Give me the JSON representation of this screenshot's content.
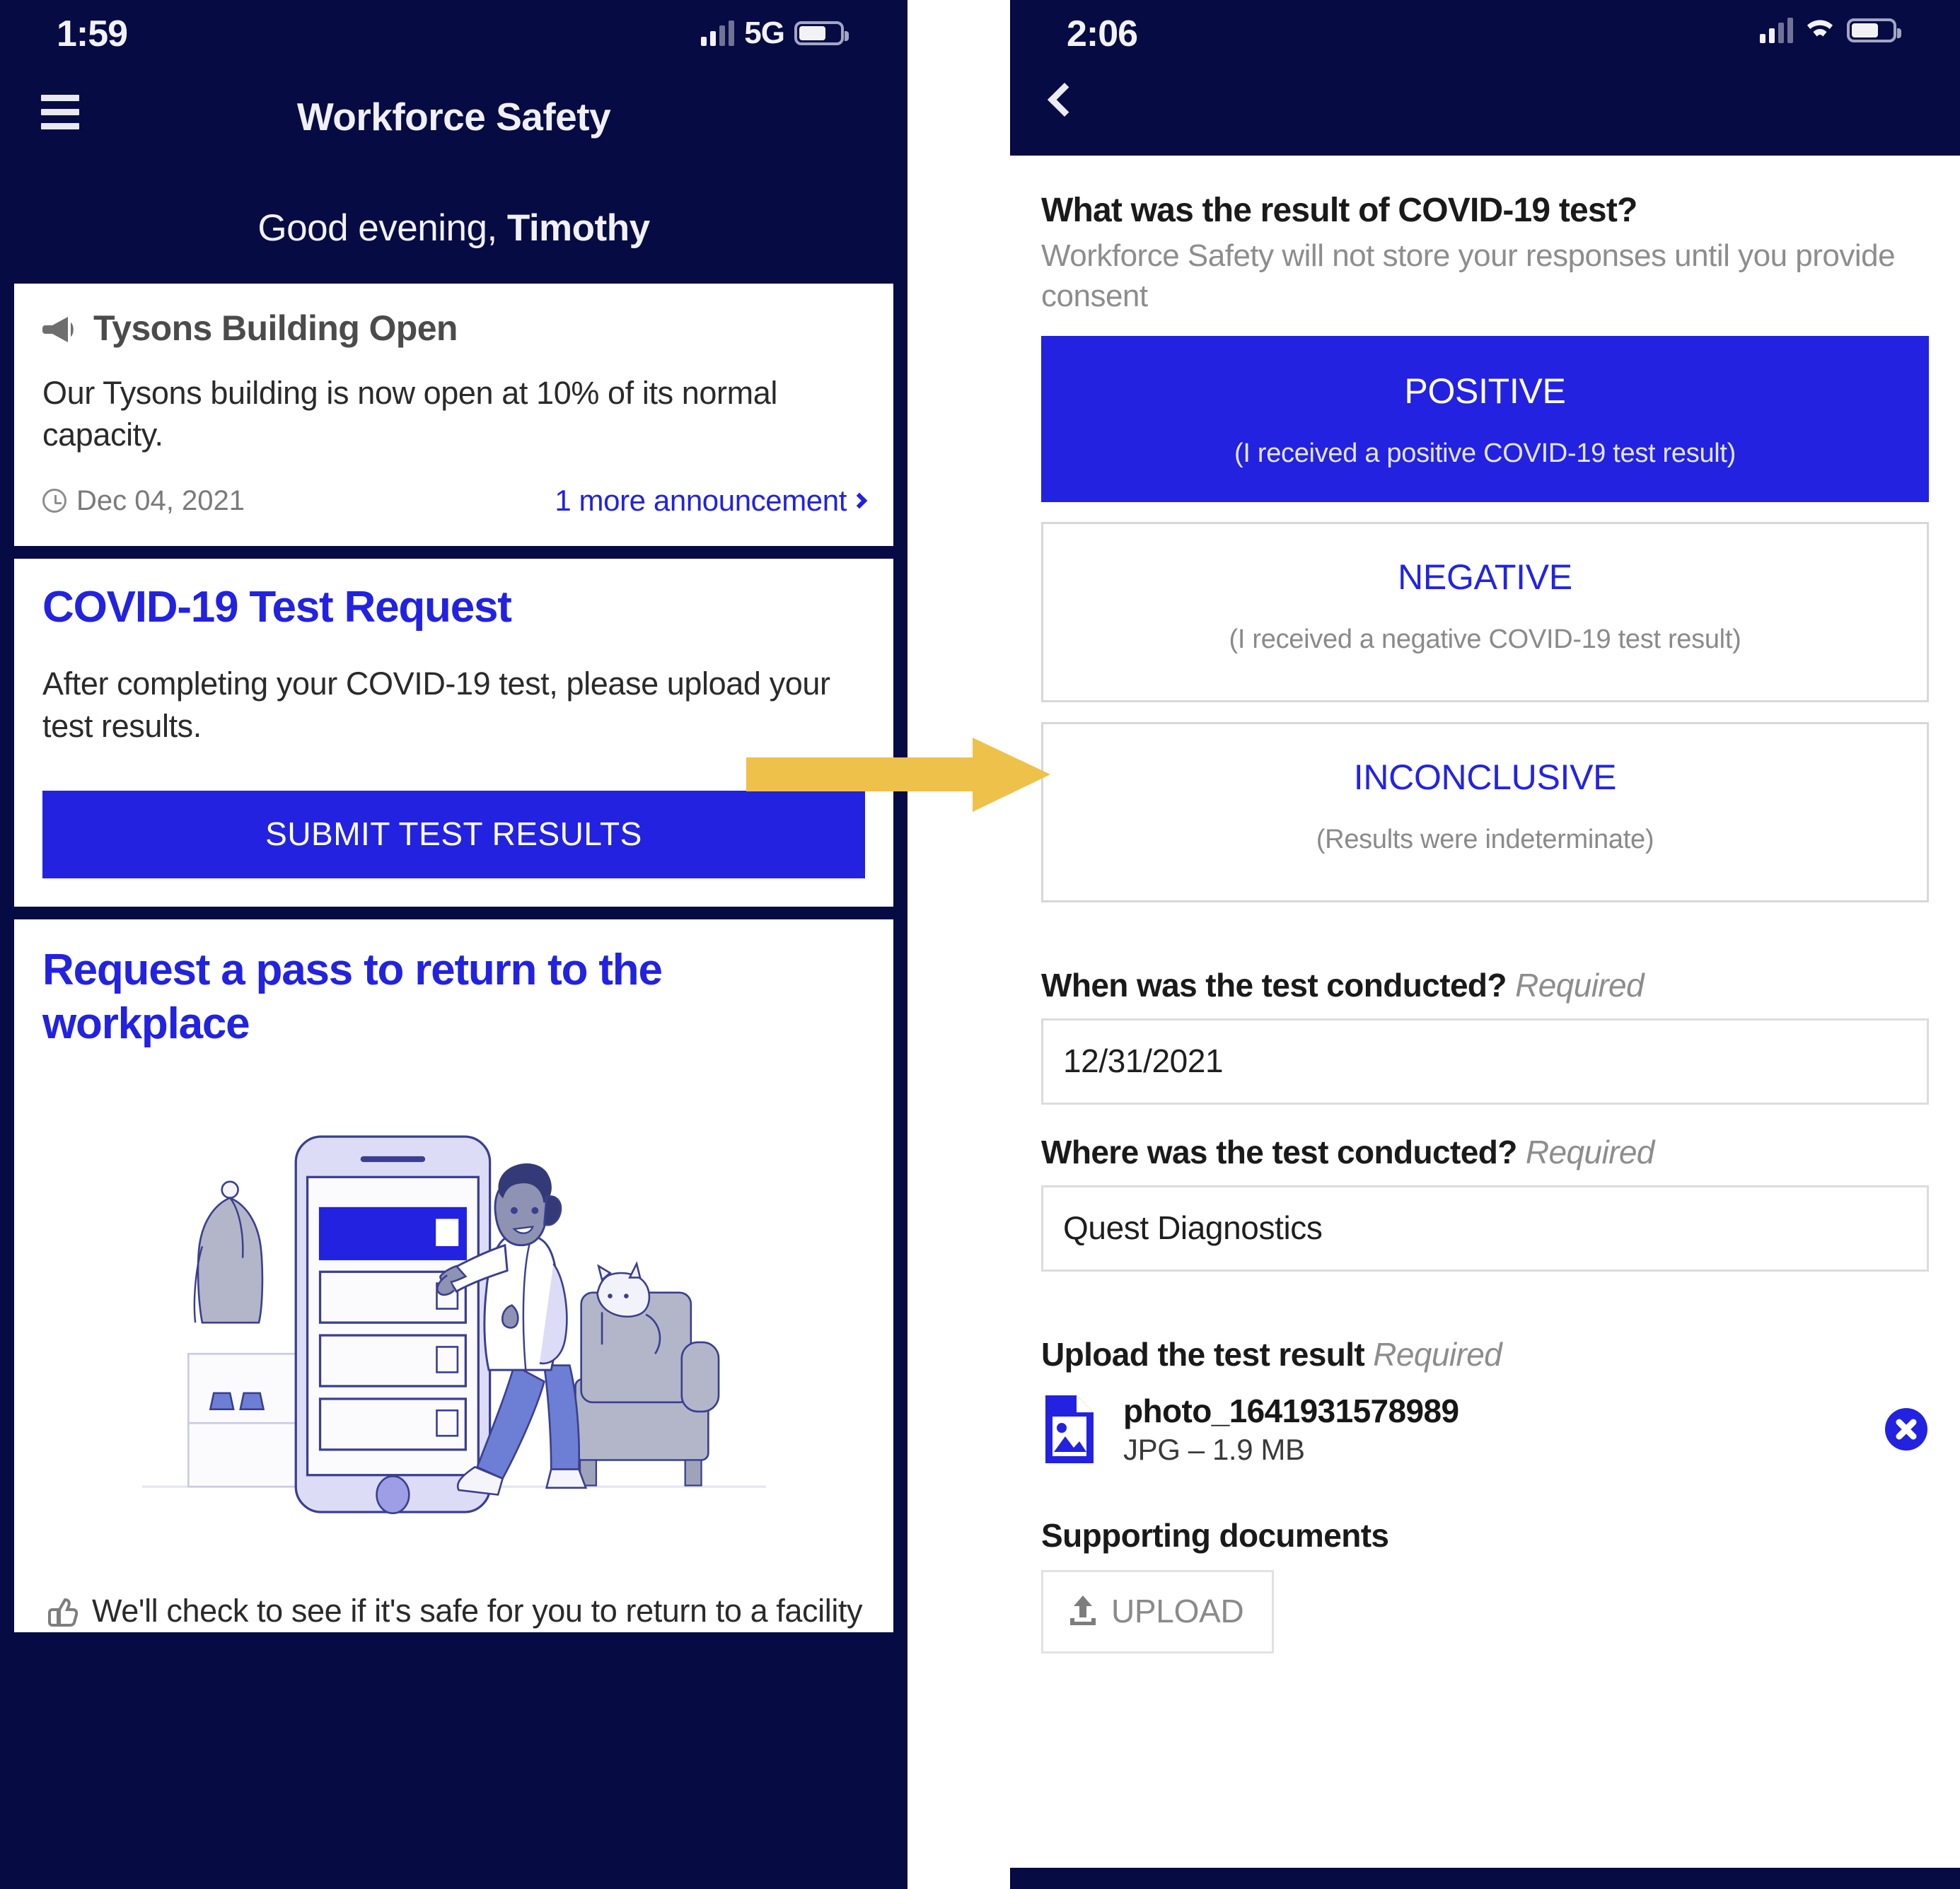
{
  "colors": {
    "navy": "#060b44",
    "brand_blue": "#2222e0",
    "accent_yellow": "#eec14a",
    "muted_grey": "#8d8d8d"
  },
  "left_phone": {
    "status": {
      "time": "1:59",
      "network": "5G",
      "signal_icon": "signal-bars-icon",
      "battery_icon": "battery-icon"
    },
    "nav": {
      "menu_icon": "hamburger-icon",
      "title": "Workforce Safety"
    },
    "greeting": {
      "prefix": "Good evening, ",
      "name": "Timothy"
    },
    "announcement": {
      "icon": "megaphone-icon",
      "title": "Tysons Building Open",
      "body": "Our Tysons building is now open at 10% of its normal capacity.",
      "date_icon": "clock-icon",
      "date": "Dec 04, 2021",
      "more_link": "1 more announcement",
      "more_icon": "chevron-right-icon"
    },
    "test_request": {
      "title": "COVID-19 Test Request",
      "body": "After completing your COVID-19 test, please upload your test results.",
      "button": "SUBMIT TEST RESULTS"
    },
    "pass_request": {
      "title": "Request a pass to return to the workplace",
      "illustration": "person-tapping-phone-illustration",
      "note_icon": "thumbs-up-icon",
      "note": "We'll check to see if it's safe for you to return to a facility"
    }
  },
  "right_phone": {
    "status": {
      "time": "2:06",
      "signal_icon": "signal-bars-icon",
      "wifi_icon": "wifi-icon",
      "battery_icon": "battery-icon"
    },
    "nav": {
      "back_icon": "chevron-left-icon"
    },
    "question": {
      "title": "What was the result of COVID-19 test?",
      "subtitle": "Workforce Safety will not store your responses until you provide consent"
    },
    "options": [
      {
        "label": "POSITIVE",
        "description": "(I received a positive COVID-19 test result)",
        "selected": true
      },
      {
        "label": "NEGATIVE",
        "description": "(I received a negative COVID-19 test result)",
        "selected": false
      },
      {
        "label": "INCONCLUSIVE",
        "description": "(Results were indeterminate)",
        "selected": false
      }
    ],
    "fields": [
      {
        "label": "When was the test conducted?",
        "required_text": "Required",
        "value": "12/31/2021"
      },
      {
        "label": "Where was the test conducted?",
        "required_text": "Required",
        "value": "Quest Diagnostics"
      }
    ],
    "upload_result": {
      "label": "Upload the test result",
      "required_text": "Required",
      "file_icon": "image-file-icon",
      "file_name": "photo_1641931578989",
      "file_meta": "JPG – 1.9 MB",
      "remove_icon": "close-circle-icon"
    },
    "supporting": {
      "label": "Supporting documents",
      "upload_icon": "upload-icon",
      "upload_label": "UPLOAD"
    }
  },
  "annotation": {
    "arrow_icon": "right-arrow-annotation"
  }
}
